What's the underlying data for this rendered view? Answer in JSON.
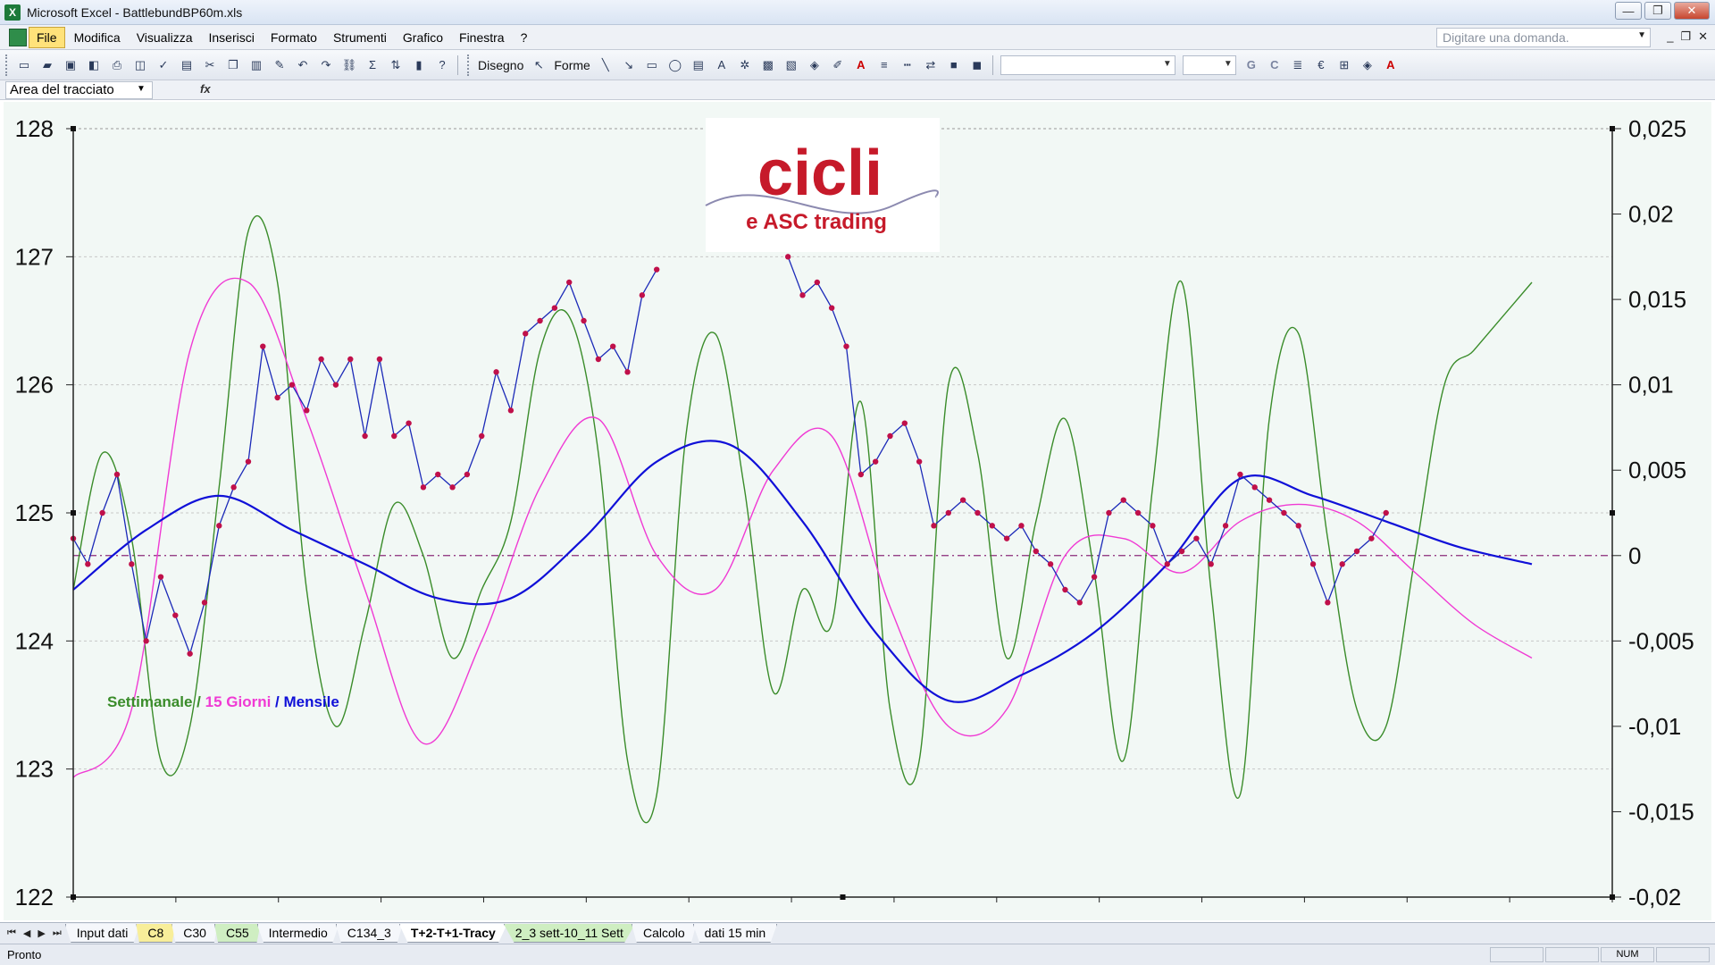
{
  "window": {
    "title": "Microsoft Excel - BattlebundBP60m.xls",
    "app_icon": "excel-icon",
    "controls": {
      "minimize": "—",
      "restore": "❐",
      "close": "✕"
    }
  },
  "menu": {
    "items": [
      "File",
      "Modifica",
      "Visualizza",
      "Inserisci",
      "Formato",
      "Strumenti",
      "Grafico",
      "Finestra",
      "?"
    ],
    "active": "File",
    "ask_placeholder": "Digitare una domanda.",
    "doc_controls": {
      "minimize": "_",
      "restore": "❐",
      "close": "✕"
    }
  },
  "toolbar": {
    "draw_label": "Disegno",
    "shapes_label": "Forme",
    "font_g": "G",
    "font_c": "C",
    "euro": "€"
  },
  "namebox": {
    "value": "Area del tracciato",
    "fx": "fx"
  },
  "chart": {
    "logo_main": "cicli",
    "logo_sub": "e ASC trading",
    "legend": {
      "weekly": "Settimanale",
      "sep1": " / ",
      "biweekly": "15 Giorni",
      "sep2": " / ",
      "monthly": "Mensile"
    },
    "colors": {
      "price_line": "#1c2ab8",
      "price_marker": "#c0104a",
      "weekly": "#3a8c2a",
      "biweekly": "#f03ad4",
      "monthly": "#1010d8",
      "zero_line": "#8a2a7a"
    }
  },
  "chart_data": {
    "type": "line",
    "left_axis": {
      "ticks": [
        "128",
        "127",
        "126",
        "125",
        "124",
        "123",
        "122"
      ],
      "ylim": [
        122,
        128
      ]
    },
    "right_axis": {
      "ticks": [
        "0,025",
        "0,02",
        "0,015",
        "0,01",
        "0,005",
        "0",
        "-0,005",
        "-0,01",
        "-0,015",
        "-0,02"
      ],
      "ylim": [
        -0.02,
        0.025
      ]
    },
    "x_range": [
      0,
      100
    ],
    "price": {
      "axis": "left",
      "x": [
        0,
        1,
        2,
        3,
        4,
        5,
        6,
        7,
        8,
        9,
        10,
        11,
        12,
        13,
        14,
        15,
        16,
        17,
        18,
        19,
        20,
        21,
        22,
        23,
        24,
        25,
        26,
        27,
        28,
        29,
        30,
        31,
        32,
        33,
        34,
        35,
        36,
        37,
        38,
        39,
        40,
        41,
        42,
        43,
        44,
        45,
        46,
        47,
        48,
        49,
        50,
        51,
        52,
        53,
        54,
        55,
        56,
        57,
        58,
        59,
        60,
        61,
        62,
        63,
        64,
        65,
        66,
        67,
        68,
        69,
        70,
        71,
        72,
        73,
        74,
        75,
        76,
        77,
        78,
        79,
        80,
        81,
        82,
        83,
        84,
        85,
        86,
        87,
        88,
        89,
        90,
        91,
        92,
        93,
        94,
        95,
        96,
        97,
        98,
        99,
        100
      ],
      "y": [
        124.8,
        124.6,
        125.0,
        125.3,
        124.6,
        124.0,
        124.5,
        124.2,
        123.9,
        124.3,
        124.9,
        125.2,
        125.4,
        126.3,
        125.9,
        126.0,
        125.8,
        126.2,
        126.0,
        126.2,
        125.6,
        126.2,
        125.6,
        125.7,
        125.2,
        125.3,
        125.2,
        125.3,
        125.6,
        126.1,
        125.8,
        126.4,
        126.5,
        126.6,
        126.8,
        126.5,
        126.2,
        126.3,
        126.1,
        126.7,
        126.9,
        null,
        null,
        null,
        null,
        null,
        null,
        null,
        null,
        127.0,
        126.7,
        126.8,
        126.6,
        126.3,
        125.3,
        125.4,
        125.6,
        125.7,
        125.4,
        124.9,
        125.0,
        125.1,
        125.0,
        124.9,
        124.8,
        124.9,
        124.7,
        124.6,
        124.4,
        124.3,
        124.5,
        125.0,
        125.1,
        125.0,
        124.9,
        124.6,
        124.7,
        124.8,
        124.6,
        124.9,
        125.3,
        125.2,
        125.1,
        125.0,
        124.9,
        124.6,
        124.3,
        124.6,
        124.7,
        124.8,
        125.0
      ],
      "end_values": [
        124.9,
        125.1
      ]
    },
    "series": [
      {
        "name": "Settimanale",
        "axis": "right",
        "x": [
          0,
          2,
          4,
          6,
          8,
          10,
          12,
          14,
          16,
          18,
          20,
          22,
          24,
          26,
          28,
          30,
          32,
          34,
          36,
          38,
          40,
          42,
          44,
          46,
          48,
          50,
          52,
          54,
          56,
          58,
          60,
          62,
          64,
          66,
          68,
          70,
          72,
          74,
          76,
          78,
          80,
          82,
          84,
          86,
          88,
          90,
          92,
          94,
          96,
          98,
          100
        ],
        "y": [
          -0.002,
          0.006,
          0.001,
          -0.012,
          -0.01,
          0.004,
          0.019,
          0.016,
          -0.002,
          -0.01,
          -0.004,
          0.003,
          0.0,
          -0.006,
          -0.002,
          0.002,
          0.012,
          0.014,
          0.006,
          -0.012,
          -0.014,
          0.007,
          0.013,
          0.004,
          -0.008,
          -0.002,
          -0.004,
          0.009,
          -0.009,
          -0.012,
          0.01,
          0.006,
          -0.006,
          0.002,
          0.008,
          -0.001,
          -0.012,
          0.004,
          0.016,
          -0.002,
          -0.014,
          0.008,
          0.013,
          0.001,
          -0.009,
          -0.01,
          0.0,
          0.01,
          0.012,
          0.014,
          0.016
        ]
      },
      {
        "name": "15 Giorni",
        "axis": "right",
        "x": [
          0,
          4,
          8,
          12,
          16,
          20,
          24,
          28,
          32,
          36,
          40,
          44,
          48,
          52,
          56,
          60,
          64,
          68,
          72,
          76,
          80,
          84,
          88,
          92,
          96,
          100
        ],
        "y": [
          -0.013,
          -0.009,
          0.012,
          0.016,
          0.008,
          -0.002,
          -0.011,
          -0.005,
          0.004,
          0.008,
          0.0,
          -0.002,
          0.005,
          0.007,
          -0.003,
          -0.01,
          -0.009,
          0.0,
          0.001,
          -0.001,
          0.002,
          0.003,
          0.002,
          -0.001,
          -0.004,
          -0.006
        ]
      },
      {
        "name": "Mensile",
        "axis": "right",
        "x": [
          0,
          5,
          10,
          15,
          20,
          25,
          30,
          35,
          40,
          45,
          50,
          55,
          60,
          65,
          70,
          75,
          80,
          85,
          90,
          95,
          100
        ],
        "y": [
          -0.002,
          0.0015,
          0.0035,
          0.0015,
          -0.0005,
          -0.0025,
          -0.0025,
          0.001,
          0.0055,
          0.0065,
          0.002,
          -0.0045,
          -0.0085,
          -0.007,
          -0.0045,
          -0.0005,
          0.0045,
          0.0035,
          0.002,
          0.0005,
          -0.0005
        ]
      }
    ]
  },
  "sheet_tabs": [
    {
      "label": "Input dati",
      "style": "plain"
    },
    {
      "label": "C8",
      "style": "yellow"
    },
    {
      "label": "C30",
      "style": "plain"
    },
    {
      "label": "C55",
      "style": "green"
    },
    {
      "label": "Intermedio",
      "style": "plain"
    },
    {
      "label": "C134_3",
      "style": "plain"
    },
    {
      "label": "T+2-T+1-Tracy",
      "style": "active"
    },
    {
      "label": "2_3 sett-10_11 Sett",
      "style": "green"
    },
    {
      "label": "Calcolo",
      "style": "plain"
    },
    {
      "label": "dati 15 min",
      "style": "plain"
    }
  ],
  "status": {
    "text": "Pronto",
    "num": "NUM"
  }
}
